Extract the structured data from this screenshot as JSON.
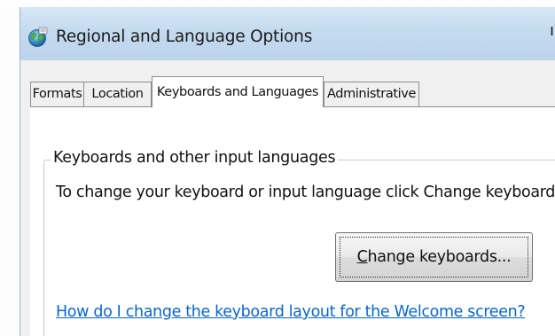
{
  "window": {
    "title": "Regional and Language Options",
    "app_icon": "globe-icon",
    "close_fragment": "ı"
  },
  "tabs": [
    {
      "label": "Formats",
      "active": false
    },
    {
      "label": "Location",
      "active": false
    },
    {
      "label": "Keyboards and Languages",
      "active": true
    },
    {
      "label": "Administrative",
      "active": false
    }
  ],
  "keyboards_group": {
    "legend": "Keyboards and other input languages",
    "description": "To change your keyboard or input language click Change keyboards.",
    "change_button_label": "Change keyboards...",
    "change_button_accelerator": "C"
  },
  "help_link": "How do I change the keyboard layout for the Welcome screen?",
  "colors": {
    "titlebar": "#c4daef",
    "link": "#0a66cc",
    "dialog_bg": "#f0f0f0"
  }
}
